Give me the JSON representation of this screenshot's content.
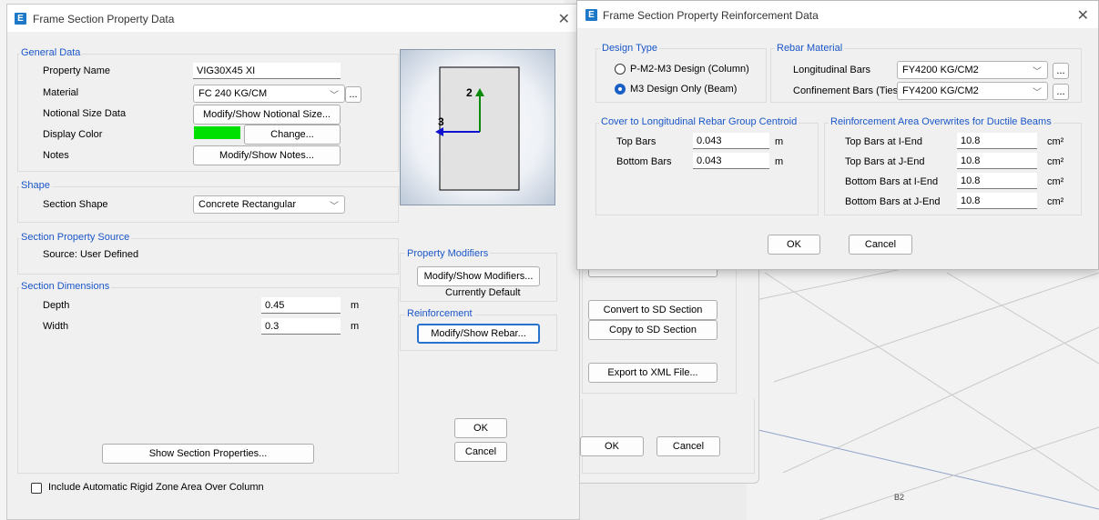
{
  "main": {
    "title": "Frame Section Property Data",
    "general": {
      "label": "General Data",
      "property_name_label": "Property Name",
      "property_name_value": "VIG30X45 XI",
      "material_label": "Material",
      "material_value": "FC 240 KG/CM",
      "notional_label": "Notional Size Data",
      "notional_button": "Modify/Show Notional Size...",
      "display_color_label": "Display Color",
      "display_color_value": "#00e000",
      "change_button": "Change...",
      "notes_label": "Notes",
      "notes_button": "Modify/Show Notes..."
    },
    "shape": {
      "label": "Shape",
      "section_shape_label": "Section Shape",
      "section_shape_value": "Concrete Rectangular"
    },
    "source": {
      "label": "Section Property Source",
      "text": "Source:  User Defined"
    },
    "dims": {
      "label": "Section Dimensions",
      "depth_label": "Depth",
      "depth_value": "0.45",
      "depth_unit": "m",
      "width_label": "Width",
      "width_value": "0.3",
      "width_unit": "m"
    },
    "preview": {
      "axis2": "2",
      "axis3": "3"
    },
    "modifiers": {
      "label": "Property Modifiers",
      "button": "Modify/Show Modifiers...",
      "status": "Currently Default"
    },
    "reinforcement": {
      "label": "Reinforcement",
      "button": "Modify/Show Rebar..."
    },
    "show_props_button": "Show Section Properties...",
    "ok": "OK",
    "cancel": "Cancel",
    "rigid_zone_label": "Include Automatic Rigid Zone Area Over Column"
  },
  "middle": {
    "convert_button": "Convert to SD Section",
    "copy_button": "Copy to SD Section",
    "export_button": "Export to XML File...",
    "ok": "OK",
    "cancel": "Cancel"
  },
  "rebar": {
    "title": "Frame Section Property Reinforcement Data",
    "design_type": {
      "label": "Design Type",
      "option1": "P-M2-M3 Design  (Column)",
      "option2": "M3 Design Only  (Beam)",
      "selected": "option2"
    },
    "rebar_material": {
      "label": "Rebar Material",
      "longitudinal_label": "Longitudinal Bars",
      "longitudinal_value": "FY4200 KG/CM2",
      "confinement_label": "Confinement Bars (Ties)",
      "confinement_value": "FY4200 KG/CM2"
    },
    "cover": {
      "label": "Cover to Longitudinal Rebar Group Centroid",
      "top_label": "Top Bars",
      "top_value": "0.043",
      "top_unit": "m",
      "bottom_label": "Bottom  Bars",
      "bottom_value": "0.043",
      "bottom_unit": "m"
    },
    "overwrites": {
      "label": "Reinforcement Area Overwrites for Ductile Beams",
      "rows": [
        {
          "label": "Top Bars at I-End",
          "value": "10.8",
          "unit": "cm²"
        },
        {
          "label": "Top Bars at J-End",
          "value": "10.8",
          "unit": "cm²"
        },
        {
          "label": "Bottom Bars at I-End",
          "value": "10.8",
          "unit": "cm²"
        },
        {
          "label": "Bottom Bars at J-End",
          "value": "10.8",
          "unit": "cm²"
        }
      ]
    },
    "ok": "OK",
    "cancel": "Cancel"
  },
  "viewport": {
    "label": "B2"
  },
  "colors": {
    "accent": "#1a56c8",
    "focus_border": "#2672cc",
    "axis_green": "#0a8a0a",
    "axis_blue": "#1010d0"
  }
}
